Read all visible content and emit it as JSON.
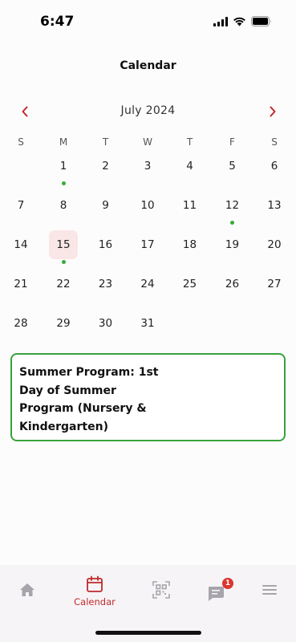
{
  "status_bar": {
    "time": "6:47"
  },
  "header": {
    "title": "Calendar"
  },
  "calendar": {
    "month_label": "July 2024",
    "weekdays": [
      "S",
      "M",
      "T",
      "W",
      "T",
      "F",
      "S"
    ],
    "weeks": [
      [
        "",
        "1",
        "2",
        "3",
        "4",
        "5",
        "6"
      ],
      [
        "7",
        "8",
        "9",
        "10",
        "11",
        "12",
        "13"
      ],
      [
        "14",
        "15",
        "16",
        "17",
        "18",
        "19",
        "20"
      ],
      [
        "21",
        "22",
        "23",
        "24",
        "25",
        "26",
        "27"
      ],
      [
        "28",
        "29",
        "30",
        "31",
        "",
        "",
        ""
      ]
    ],
    "selected_day": "15",
    "event_days": [
      "1",
      "12",
      "15"
    ],
    "event_dot_color": "#3aaa3a",
    "selected_bg_color": "#f9e6e6"
  },
  "event": {
    "title": "Summer Program: 1st Day of Summer Program (Nursery & Kindergarten)"
  },
  "tab_bar": {
    "tabs": [
      {
        "id": "home",
        "icon": "home-icon",
        "label": ""
      },
      {
        "id": "calendar",
        "icon": "calendar-icon",
        "label": "Calendar",
        "active": true
      },
      {
        "id": "scan",
        "icon": "qr-scan-icon",
        "label": ""
      },
      {
        "id": "messages",
        "icon": "message-icon",
        "label": "",
        "badge": "1"
      },
      {
        "id": "menu",
        "icon": "hamburger-menu-icon",
        "label": ""
      }
    ],
    "active_color": "#c0292b",
    "inactive_color": "#a8a4ab"
  }
}
